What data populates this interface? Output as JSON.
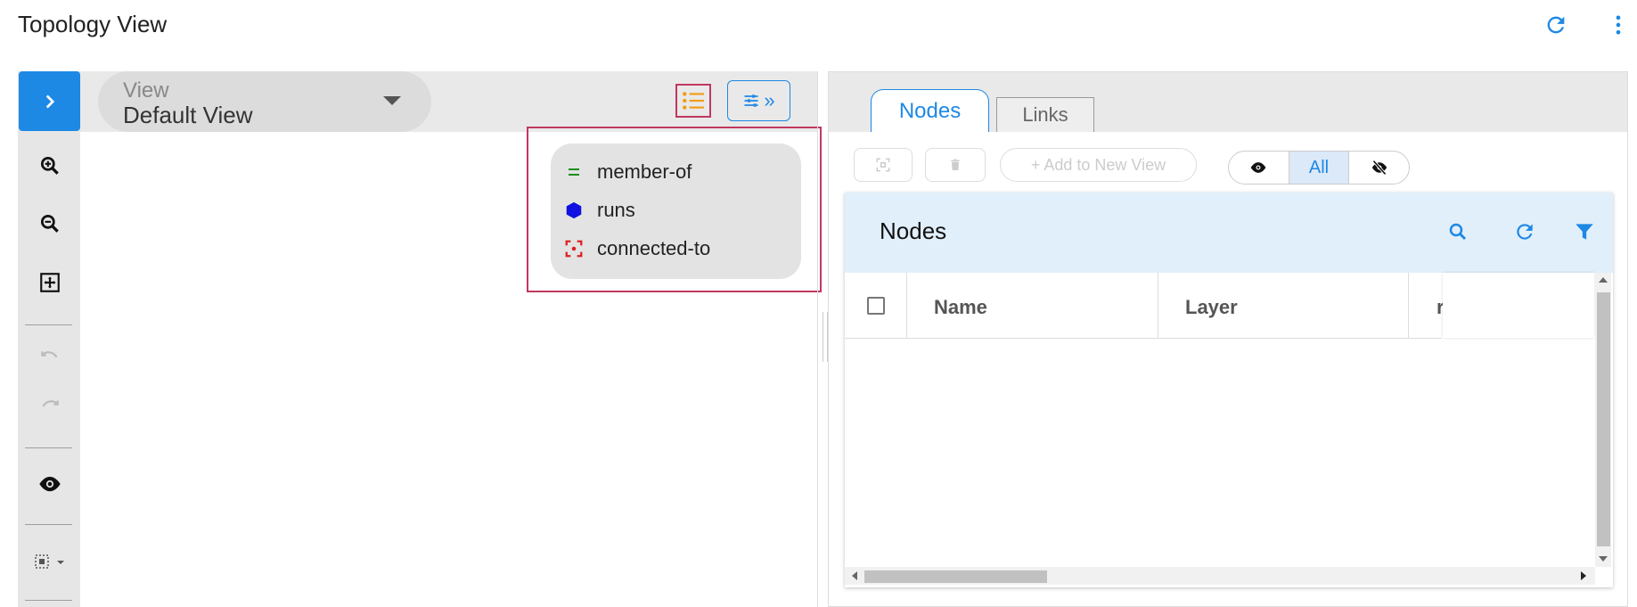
{
  "app": {
    "title": "Topology View"
  },
  "header_actions": {
    "refresh_icon": "refresh-icon",
    "more_icon": "more-vert-icon"
  },
  "view_selector": {
    "label": "View",
    "value": "Default View"
  },
  "legend": {
    "items": [
      {
        "label": "member-of",
        "icon": "equals-icon",
        "color": "#1e8e1e"
      },
      {
        "label": "runs",
        "icon": "hexagon-icon",
        "color": "#1010e0"
      },
      {
        "label": "connected-to",
        "icon": "focus-square-icon",
        "color": "#e02020"
      }
    ]
  },
  "right_panel": {
    "tabs": [
      {
        "label": "Nodes"
      },
      {
        "label": "Links"
      }
    ],
    "actions": {
      "add_to_view": "+ Add to New View"
    },
    "visibility": {
      "all_label": "All"
    },
    "nodes": {
      "title": "Nodes",
      "columns": [
        "Name",
        "Layer",
        "r"
      ]
    }
  },
  "colors": {
    "accent": "#1e88e5",
    "highlight": "#c0385f",
    "header_bg": "#e1effa"
  }
}
